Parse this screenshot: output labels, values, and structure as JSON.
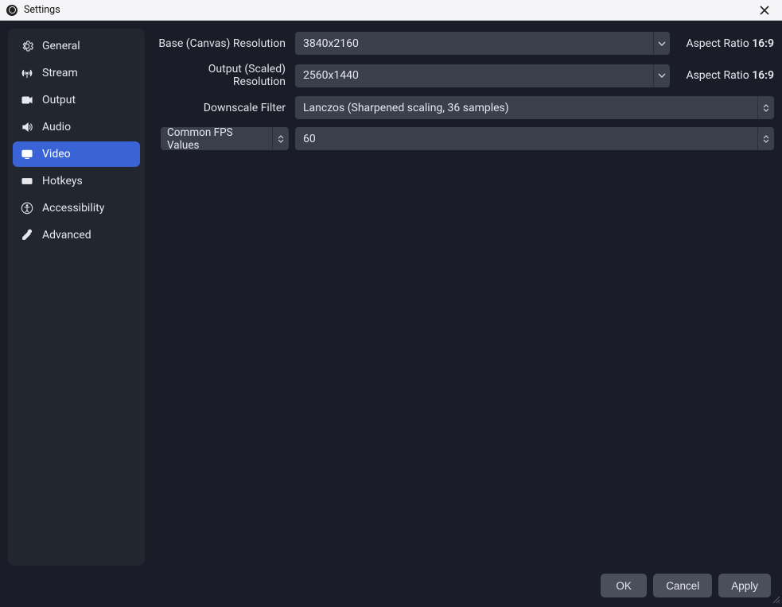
{
  "window": {
    "title": "Settings"
  },
  "sidebar": {
    "items": [
      {
        "label": "General"
      },
      {
        "label": "Stream"
      },
      {
        "label": "Output"
      },
      {
        "label": "Audio"
      },
      {
        "label": "Video"
      },
      {
        "label": "Hotkeys"
      },
      {
        "label": "Accessibility"
      },
      {
        "label": "Advanced"
      }
    ],
    "active_index": 4
  },
  "content": {
    "base_res": {
      "label": "Base (Canvas) Resolution",
      "value": "3840x2160",
      "aspect_label": "Aspect Ratio",
      "aspect_value": "16:9"
    },
    "output_res": {
      "label": "Output (Scaled) Resolution",
      "value": "2560x1440",
      "aspect_label": "Aspect Ratio",
      "aspect_value": "16:9"
    },
    "downscale": {
      "label": "Downscale Filter",
      "value": "Lanczos (Sharpened scaling, 36 samples)"
    },
    "fps": {
      "label": "Common FPS Values",
      "value": "60"
    }
  },
  "footer": {
    "ok": "OK",
    "cancel": "Cancel",
    "apply": "Apply"
  }
}
